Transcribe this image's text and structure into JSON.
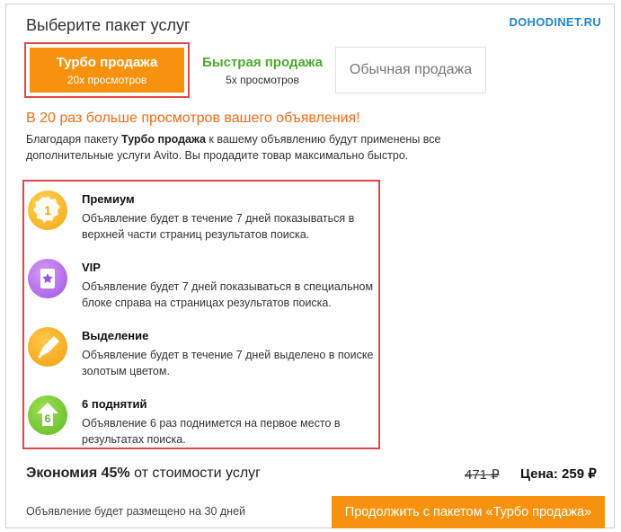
{
  "watermark": "DOHODINET.RU",
  "page_title": "Выберите пакет услуг",
  "tabs": [
    {
      "name": "Турбо продажа",
      "sub": "20x просмотров"
    },
    {
      "name": "Быстрая продажа",
      "sub": "5x просмотров"
    },
    {
      "name": "Обычная продажа",
      "sub": ""
    }
  ],
  "headline": "В 20 раз больше просмотров вашего объявления!",
  "description": {
    "before": "Благодаря пакету ",
    "bold": "Турбо продажа",
    "after": " к вашему объявлению будут применены все дополнительные услуги Avito. Вы продадите товар максимально быстро."
  },
  "features": [
    {
      "title": "Премиум",
      "text": "Объявление будет в течение 7 дней показываться в верхней части страниц результатов поиска.",
      "icon": "medal-1-icon",
      "glyph": "1",
      "color": "#f3a80f"
    },
    {
      "title": "VIP",
      "text": "Объявление будет 7 дней показываться в специальном блоке справа на страницах результатов поиска.",
      "icon": "vip-star-card-icon",
      "glyph": "",
      "color": "#a052e6"
    },
    {
      "title": "Выделение",
      "text": "Объявление будет в течение 7 дней выделено в поиске золотым цветом.",
      "icon": "highlighter-icon",
      "glyph": "",
      "color": "#f39c10"
    },
    {
      "title": "6 поднятий",
      "text": "Объявление 6 раз поднимется на первое место в результатах поиска.",
      "icon": "arrow-up-6-icon",
      "glyph": "6",
      "color": "#5db824"
    }
  ],
  "summary": {
    "bold": "Экономия 45%",
    "rest": " от стоимости услуг"
  },
  "old_price": "471 ₽",
  "price": "Цена: 259 ₽",
  "footnote": "Объявление будет размещено на 30 дней",
  "cta_label": "Продолжить с пакетом «Турбо продажа»"
}
